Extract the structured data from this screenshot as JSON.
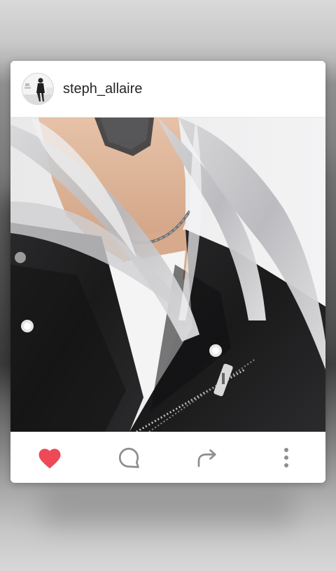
{
  "post": {
    "username": "steph_allaire",
    "avatar_icon": "user-avatar",
    "photo_subject": "photo"
  },
  "actions": {
    "like_icon": "heart-icon",
    "comment_icon": "comment-icon",
    "share_icon": "share-icon",
    "more_icon": "more-vertical-icon",
    "liked": true
  },
  "colors": {
    "like": "#ed4956",
    "icon_gray": "#8e8e8e",
    "card": "#ffffff",
    "username": "#262626"
  }
}
